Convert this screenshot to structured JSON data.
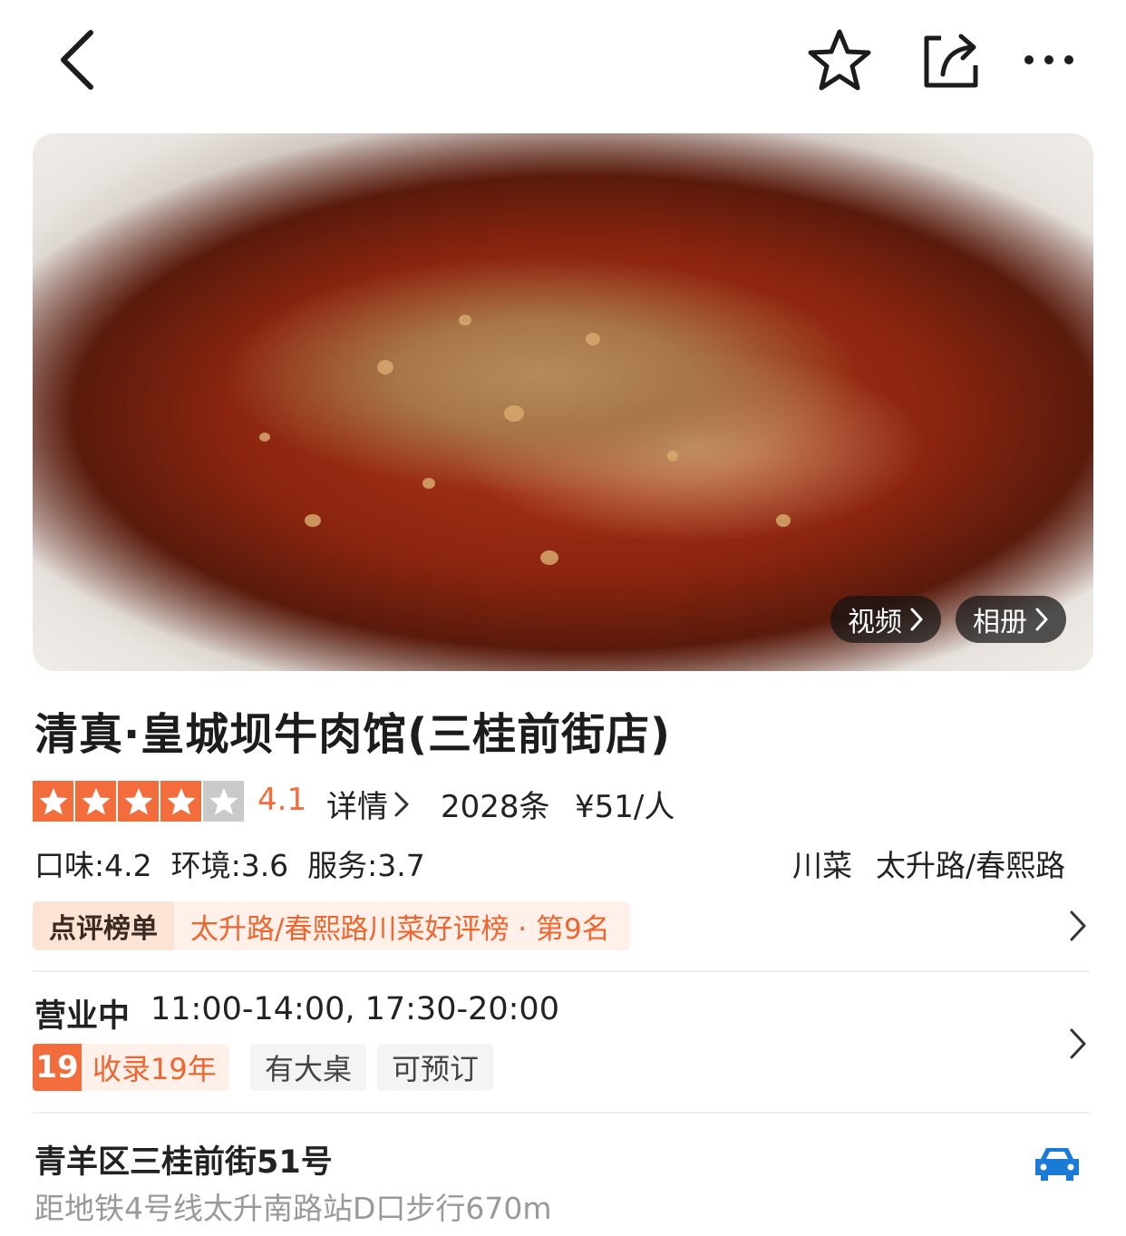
{
  "nav": {
    "back_icon": "chevron-left-icon",
    "favorite_icon": "star-outline-icon",
    "share_icon": "share-icon",
    "more_icon": "more-horizontal-icon"
  },
  "hero": {
    "video_label": "视频",
    "album_label": "相册"
  },
  "shop": {
    "name": "清真·皇城坝牛肉馆(三桂前街店)",
    "star_count": 4,
    "star_max": 5,
    "rating": "4.1",
    "details_label": "详情",
    "review_count": "2028条",
    "price": "¥51/人",
    "scores": "口味:4.2  环境:3.6  服务:3.7",
    "cuisine": "川菜",
    "area": "太升路/春熙路"
  },
  "rank": {
    "badge": "点评榜单",
    "text": "太升路/春熙路川菜好评榜 · 第9名"
  },
  "hours": {
    "status": "营业中",
    "time": "11:00-14:00, 17:30-20:00"
  },
  "tags": {
    "years_number": "19",
    "years_label": "收录19年",
    "big_table": "有大桌",
    "reservable": "可预订"
  },
  "address": {
    "line": "青羊区三桂前街51号",
    "transit": "距地铁4号线太升南路站D口步行670m"
  },
  "colors": {
    "accent": "#f36c3c",
    "star_fill": "#f36c3c",
    "star_empty": "#c9c9c9",
    "car_icon": "#1a7bd6"
  }
}
